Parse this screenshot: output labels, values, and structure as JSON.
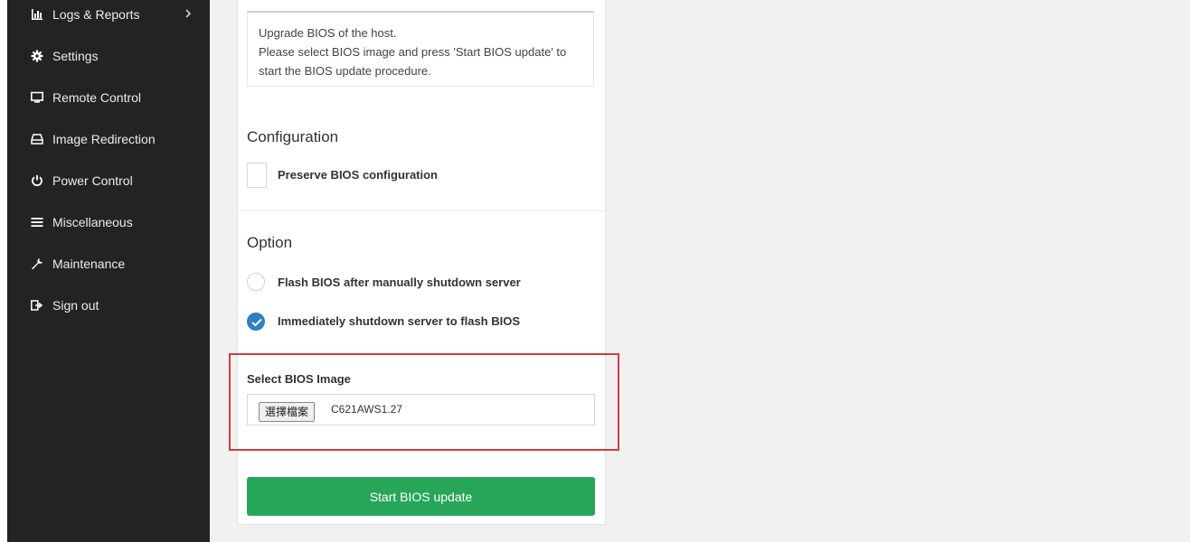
{
  "sidebar": {
    "items": [
      {
        "label": "Logs & Reports",
        "icon": "bar-chart-icon",
        "has_arrow": true
      },
      {
        "label": "Settings",
        "icon": "gear-icon"
      },
      {
        "label": "Remote Control",
        "icon": "monitor-icon"
      },
      {
        "label": "Image Redirection",
        "icon": "drive-icon"
      },
      {
        "label": "Power Control",
        "icon": "power-icon"
      },
      {
        "label": "Miscellaneous",
        "icon": "menu-icon"
      },
      {
        "label": "Maintenance",
        "icon": "wrench-icon"
      },
      {
        "label": "Sign out",
        "icon": "sign-out-icon"
      }
    ]
  },
  "info": {
    "line1": "Upgrade BIOS of the host.",
    "line2": "Please select BIOS image and press 'Start BIOS update' to",
    "line3": "start the BIOS update procedure."
  },
  "configuration": {
    "title": "Configuration",
    "preserve_label": "Preserve BIOS configuration",
    "preserve_checked": false
  },
  "option": {
    "title": "Option",
    "radio1_label": "Flash BIOS after manually shutdown server",
    "radio2_label": "Immediately shutdown server to flash BIOS",
    "selected": "radio2"
  },
  "bios_image": {
    "label": "Select BIOS Image",
    "choose_button": "選擇檔案",
    "file_name": "C621AWS1.27"
  },
  "start_button": "Start BIOS update",
  "colors": {
    "sidebar_bg": "#232323",
    "accent_green": "#27a65a",
    "radio_blue": "#2d7fc6",
    "highlight_red": "#d03d3d"
  }
}
